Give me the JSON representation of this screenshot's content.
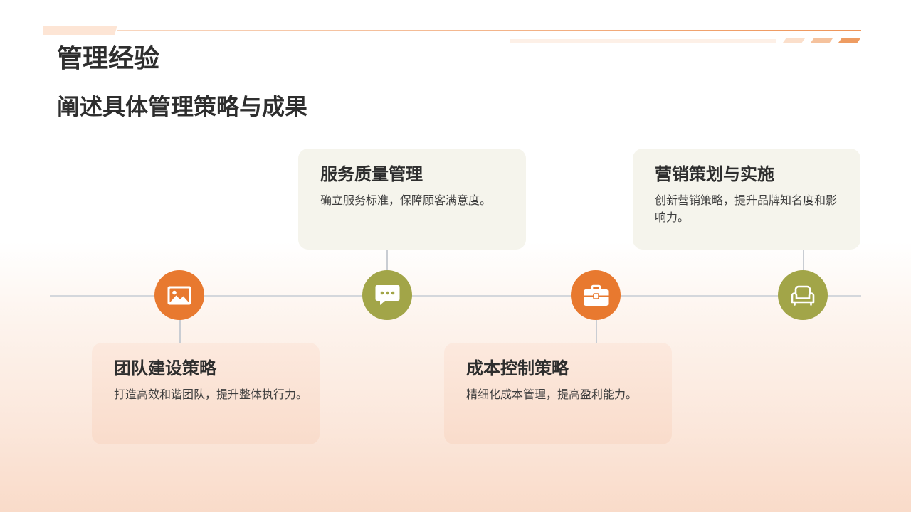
{
  "slide": {
    "title": "管理经验",
    "subtitle": "阐述具体管理策略与成果"
  },
  "theme": {
    "accent_orange": "#E8792F",
    "accent_olive": "#A2A548",
    "card_top_bg": "#F5F4EC",
    "card_bottom_bg": "#FAE2D4",
    "timeline_line": "#D4D7DC"
  },
  "timeline": {
    "items": [
      {
        "title": "团队建设策略",
        "description": "打造高效和谐团队，提升整体执行力。",
        "icon": "image-icon",
        "color": "#E8792F"
      },
      {
        "title": "服务质量管理",
        "description": "确立服务标准，保障顾客满意度。",
        "icon": "chat-bubble-icon",
        "color": "#A2A548"
      },
      {
        "title": "成本控制策略",
        "description": "精细化成本管理，提高盈利能力。",
        "icon": "briefcase-icon",
        "color": "#E8792F"
      },
      {
        "title": "营销策划与实施",
        "description": "创新营销策略，提升品牌知名度和影响力。",
        "icon": "armchair-icon",
        "color": "#A2A548"
      }
    ]
  }
}
